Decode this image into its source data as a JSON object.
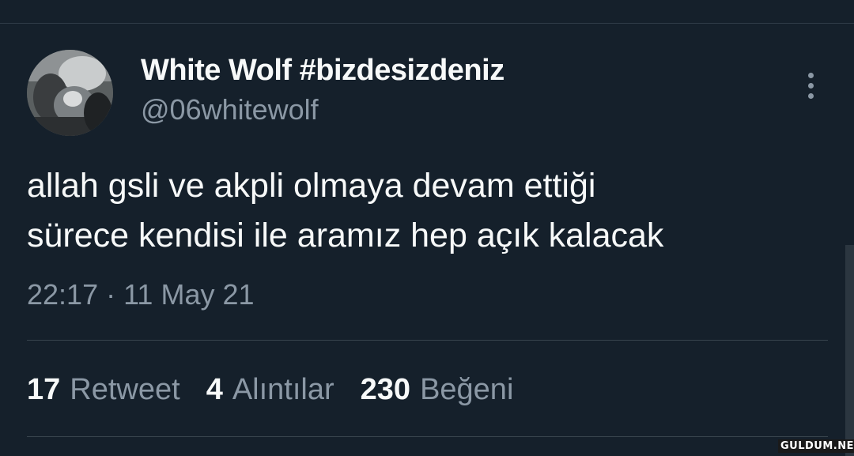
{
  "author": {
    "display_name": "White Wolf #bizdesizdeniz",
    "handle": "@06whitewolf"
  },
  "tweet": {
    "text_lines": [
      "allah gsli ve akpli olmaya devam ettiği",
      "sürece kendisi ile aramız hep açık kalacak"
    ],
    "timestamp": "22:17 · 11 May 21"
  },
  "stats": [
    {
      "count": "17",
      "label": "Retweet"
    },
    {
      "count": "4",
      "label": "Alıntılar"
    },
    {
      "count": "230",
      "label": "Beğeni"
    }
  ],
  "icons": {
    "more": "more-vertical-icon",
    "avatar": "avatar-photo"
  },
  "colors": {
    "background": "#15202b",
    "primary_text": "#f7f9f9",
    "secondary_text": "#8b98a5",
    "divider": "#38444d"
  },
  "watermark": "GULDUM.NET"
}
